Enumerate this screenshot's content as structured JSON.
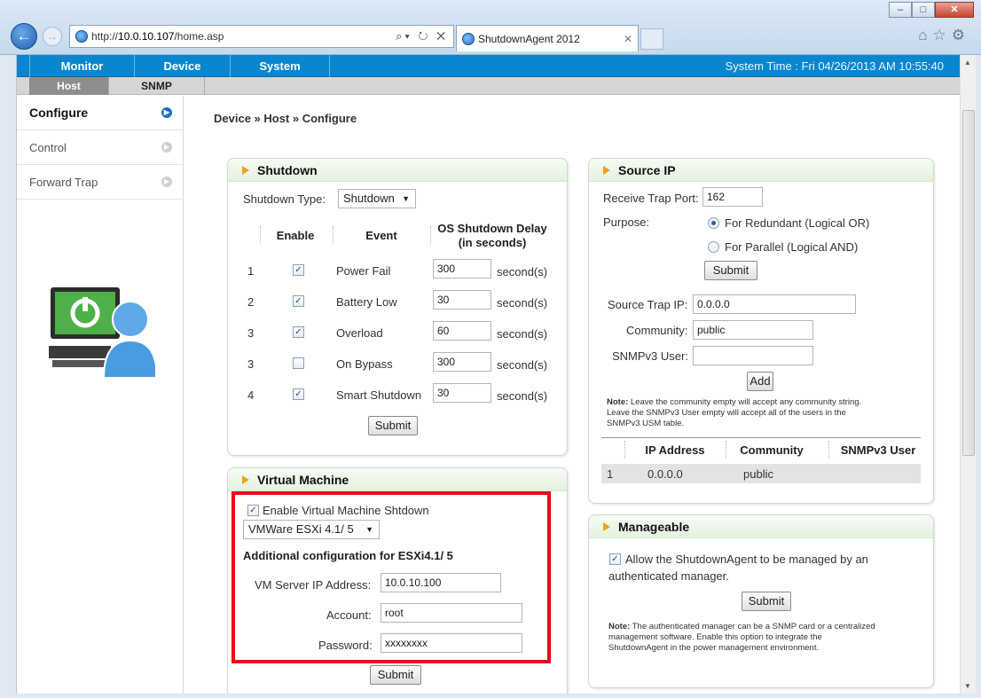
{
  "browser": {
    "url": "http://10.0.10.107/home.asp",
    "url_prefix": "http://",
    "url_host": "10.0.10.107",
    "url_path": "/home.asp",
    "tab_title": "ShutdownAgent 2012"
  },
  "topnav": {
    "items": [
      "Monitor",
      "Device",
      "System"
    ],
    "system_time": "System Time : Fri 04/26/2013 AM 10:55:40"
  },
  "subnav": {
    "items": [
      "Host",
      "SNMP"
    ]
  },
  "sidebar": {
    "items": [
      "Configure",
      "Control",
      "Forward Trap"
    ]
  },
  "breadcrumb": "Device » Host » Configure",
  "shutdown": {
    "title": "Shutdown",
    "type_label": "Shutdown Type:",
    "type_value": "Shutdown",
    "col_enable": "Enable",
    "col_event": "Event",
    "col_delay": "OS Shutdown Delay",
    "col_delay_unit": "(in seconds)",
    "rows": [
      {
        "num": "1",
        "checked": true,
        "event": "Power Fail",
        "delay": "300",
        "unit": "second(s)"
      },
      {
        "num": "2",
        "checked": true,
        "event": "Battery Low",
        "delay": "30",
        "unit": "second(s)"
      },
      {
        "num": "3",
        "checked": true,
        "event": "Overload",
        "delay": "60",
        "unit": "second(s)"
      },
      {
        "num": "3",
        "checked": false,
        "event": "On Bypass",
        "delay": "300",
        "unit": "second(s)"
      },
      {
        "num": "4",
        "checked": true,
        "event": "Smart Shutdown",
        "delay": "30",
        "unit": "second(s)"
      }
    ],
    "submit": "Submit"
  },
  "vm": {
    "title": "Virtual Machine",
    "enable_label": "Enable Virtual Machine Shtdown",
    "platform": "VMWare ESXi 4.1/ 5",
    "config_heading": "Additional configuration for ESXi4.1/ 5",
    "ip_label": "VM Server IP Address:",
    "ip_value": "10.0.10.100",
    "account_label": "Account:",
    "account_value": "root",
    "password_label": "Password:",
    "password_value": "xxxxxxxx",
    "submit": "Submit"
  },
  "source_ip": {
    "title": "Source IP",
    "port_label": "Receive Trap Port:",
    "port_value": "162",
    "purpose_label": "Purpose:",
    "opt_redundant": "For Redundant (Logical OR)",
    "opt_parallel": "For Parallel (Logical AND)",
    "submit": "Submit",
    "trap_ip_label": "Source Trap IP:",
    "trap_ip_value": "0.0.0.0",
    "community_label": "Community:",
    "community_value": "public",
    "snmpv3_label": "SNMPv3 User:",
    "snmpv3_value": "",
    "add": "Add",
    "note_bold": "Note:",
    "note_1": " Leave the community empty will accept any community string.",
    "note_2": "Leave the SNMPv3 User empty will accept all of the users in the",
    "note_3": "SNMPv3 USM table.",
    "col_ip": "IP Address",
    "col_community": "Community",
    "col_snmpv3": "SNMPv3 User",
    "table_rows": [
      {
        "num": "1",
        "ip": "0.0.0.0",
        "community": "public",
        "snmpv3": ""
      }
    ]
  },
  "manageable": {
    "title": "Manageable",
    "allow_label_1": "Allow the ShutdownAgent to be managed by an",
    "allow_label_2": "authenticated manager.",
    "submit": "Submit",
    "note_bold": "Note:",
    "note_1": " The authenticated manager can be a SNMP card or a centralized",
    "note_2": "management software. Enable this option to integrate the",
    "note_3": "ShutdownAgent in the power management environment."
  },
  "colors": {
    "nav_blue": "#0a86d0",
    "accent_orange": "#f0a21b",
    "highlight_red": "#e0101a",
    "active_arrow": "#1b6fc3"
  },
  "icons": {
    "back": "back-arrow-icon",
    "forward": "forward-arrow-icon",
    "site": "globe-icon",
    "home": "home-icon",
    "favorites": "star-icon",
    "settings": "gear-icon",
    "side_arrow": "chevron-circle-right-icon",
    "section": "triangle-right-icon",
    "computer": "computer-user-icon"
  }
}
